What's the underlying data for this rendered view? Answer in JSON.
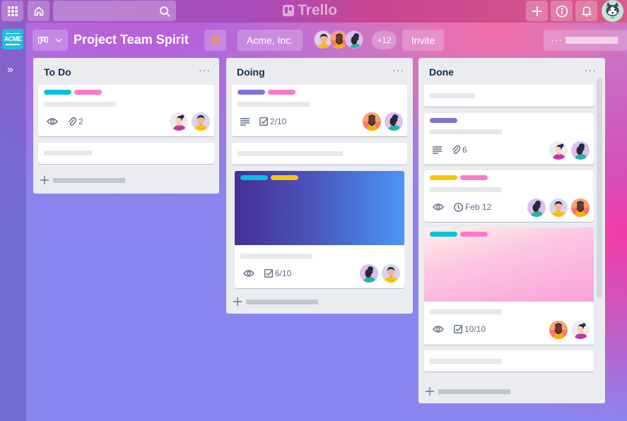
{
  "topnav": {
    "apps_icon": "grid-icon",
    "home_icon": "home-icon",
    "search_placeholder": "",
    "logo_text": "Trello",
    "create_icon": "plus-icon",
    "info_icon": "info-icon",
    "notifications_icon": "bell-icon",
    "account_avatar": "husky-avatar"
  },
  "rail": {
    "workspace_logo": "ACME",
    "expand_icon": "»"
  },
  "board": {
    "view_switcher_icon": "board-icon",
    "title": "Project Team Spirit",
    "star_icon": "☆",
    "workspace": "Acme, Inc.",
    "members_extra": "+12",
    "invite_label": "Invite",
    "menu_dots": "···"
  },
  "colors": {
    "label_cyan": "#00c2e0",
    "label_pink": "#ff78cb",
    "label_purple": "#8270db",
    "label_yellow": "#ffc400",
    "star": "#f2a70f",
    "list_bg": "#ebecf0",
    "title_text": "#172b4d"
  },
  "lists": [
    {
      "title": "To Do",
      "menu": "···",
      "cards": [
        {
          "labels": [
            "cyan",
            "pink"
          ],
          "badges": {
            "watch": true,
            "attachments": "2"
          },
          "members": [
            "woman-magenta",
            "man-yellow"
          ]
        },
        {
          "labels": [],
          "badges": {},
          "members": []
        }
      ]
    },
    {
      "title": "Doing",
      "menu": "···",
      "cards": [
        {
          "labels": [
            "purple",
            "pink"
          ],
          "badges": {
            "description": true,
            "checklist": "2/10"
          },
          "members": [
            "man-orange",
            "woman-teal"
          ]
        },
        {
          "labels": [],
          "badges": {},
          "members": []
        },
        {
          "cover": "blue-gradient",
          "labels": [
            "cyan",
            "yellow"
          ],
          "badges": {
            "watch": true,
            "checklist": "6/10"
          },
          "members": [
            "woman-teal",
            "man-yellow"
          ]
        }
      ]
    },
    {
      "title": "Done",
      "menu": "···",
      "cards": [
        {
          "labels": [],
          "badges": {},
          "members": []
        },
        {
          "labels": [
            "purple"
          ],
          "badges": {
            "description": true,
            "attachments": "6"
          },
          "members": [
            "woman-magenta",
            "woman-teal"
          ]
        },
        {
          "labels": [
            "yellow",
            "pink"
          ],
          "badges": {
            "watch": true,
            "due": "Feb 12"
          },
          "members": [
            "woman-teal",
            "man-yellow",
            "man-orange"
          ]
        },
        {
          "cover": "pink-gradient",
          "labels": [
            "cyan",
            "pink"
          ],
          "badges": {
            "watch": true,
            "checklist": "10/10"
          },
          "members": [
            "man-orange",
            "woman-magenta"
          ]
        },
        {
          "labels": [],
          "badges": {},
          "members": []
        }
      ]
    }
  ]
}
